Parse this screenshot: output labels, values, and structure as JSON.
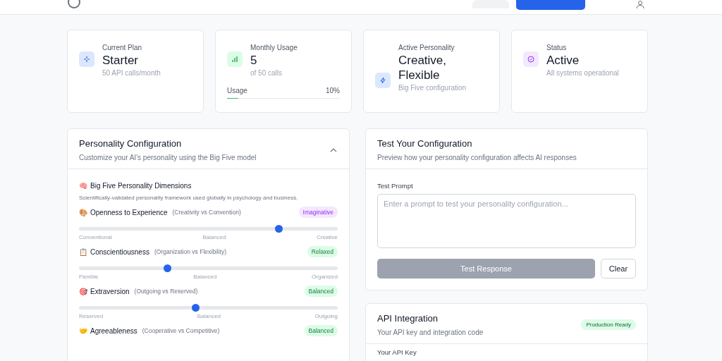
{
  "stats": [
    {
      "kind": "plan",
      "label": "Current Plan",
      "value": "Starter",
      "sub": "50 API calls/month",
      "color": "#dbe7fd"
    },
    {
      "kind": "usage",
      "label": "Monthly Usage",
      "value": "5",
      "sub": "of 50 calls",
      "meter_label": "Usage",
      "meter_reading": "10%",
      "level": 0.1,
      "color": "#dcfce7"
    },
    {
      "kind": "personality",
      "label": "Active Personality",
      "value": "Creative, Flexible",
      "sub": "Big Five configuration",
      "color": "#dbe7fd"
    },
    {
      "kind": "status",
      "label": "Status",
      "value": "Active",
      "sub": "All systems operational",
      "color": "#f3e8ff"
    }
  ],
  "config": {
    "title": "Personality Configuration",
    "subtitle": "Customize your AI's personality using the Big Five model",
    "expanded": true,
    "section_icon": "🧠",
    "section_title": "Big Five Personality Dimensions",
    "section_text": "Scientifically-validated personality framework used globally in psychology and business.",
    "traits": [
      {
        "icon": "🎨",
        "name": "Openness to Experience",
        "hint": "(Creativity vs Convention)",
        "tag": "Imaginative",
        "color": "#f3e8ff",
        "level": 0.77,
        "low": "Conventional",
        "mid": "Balanced",
        "high": "Creative"
      },
      {
        "icon": "📋",
        "name": "Conscientiousness",
        "hint": "(Organization vs Flexibility)",
        "tag": "Relaxed",
        "color": "#dcfce7",
        "level": 0.34,
        "low": "Flexible",
        "mid": "Balanced",
        "high": "Organized"
      },
      {
        "icon": "🎯",
        "name": "Extraversion",
        "hint": "(Outgoing vs Reserved)",
        "tag": "Balanced",
        "color": "#dcfce7",
        "level": 0.45,
        "low": "Reserved",
        "mid": "Balanced",
        "high": "Outgoing"
      },
      {
        "icon": "🤝",
        "name": "Agreeableness",
        "hint": "(Cooperative vs Competitive)",
        "tag": "Balanced",
        "color": "#dcfce7"
      }
    ]
  },
  "test": {
    "title": "Test Your Configuration",
    "subtitle": "Preview how your personality configuration affects AI responses",
    "field_label": "Test Prompt",
    "placeholder": "Enter a prompt to test your personality configuration...",
    "submit": "Test Response",
    "submit_disabled": true,
    "clear": "Clear"
  },
  "api": {
    "title": "API Integration",
    "subtitle": "Your API key and integration code",
    "badge": "Production Ready",
    "key_label": "Your API Key"
  }
}
